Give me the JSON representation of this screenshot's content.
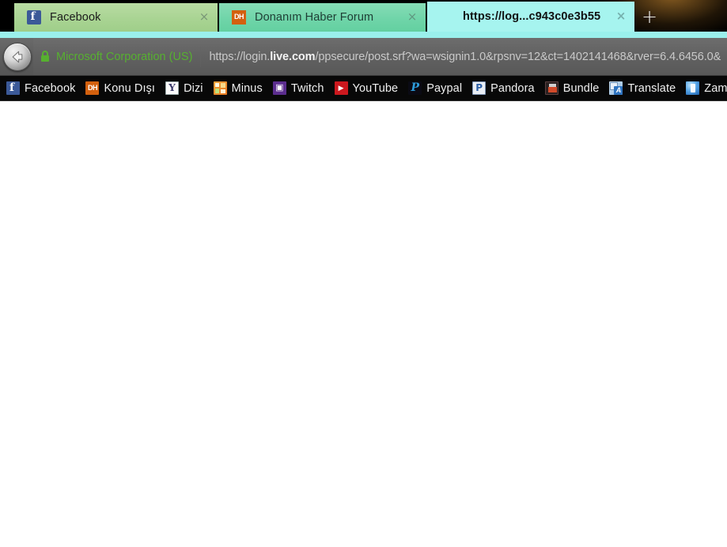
{
  "browser": {
    "tabs": [
      {
        "title": "Facebook",
        "favicon": "facebook-icon",
        "close_label": "×",
        "active": false
      },
      {
        "title": "Donanım Haber Forum",
        "favicon": "donanimhaber-icon",
        "close_label": "×",
        "active": false
      },
      {
        "title": "https://log...c943c0e3b55",
        "favicon": "microsoft-icon",
        "close_label": "×",
        "active": true
      }
    ],
    "new_tab_label": "+",
    "toolbar": {
      "back_button_label": "Back",
      "site_identity": "Microsoft Corporation (US)",
      "url_prefix": "https://login.",
      "url_host": "live.com",
      "url_suffix": "/ppsecure/post.srf?wa=wsignin1.0&rpsnv=12&ct=1402141468&rver=6.4.6456.0&",
      "url_full": "https://login.live.com/ppsecure/post.srf?wa=wsignin1.0&rpsnv=12&ct=1402141468&rver=6.4.6456.0&"
    },
    "bookmarks": [
      {
        "label": "Facebook",
        "icon": "facebook-icon"
      },
      {
        "label": "Konu Dışı",
        "icon": "donanimhaber-icon"
      },
      {
        "label": "Dizi",
        "icon": "yahoo-icon"
      },
      {
        "label": "Minus",
        "icon": "minus-icon"
      },
      {
        "label": "Twitch",
        "icon": "twitch-icon"
      },
      {
        "label": "YouTube",
        "icon": "youtube-icon"
      },
      {
        "label": "Paypal",
        "icon": "paypal-icon"
      },
      {
        "label": "Pandora",
        "icon": "pandora-icon"
      },
      {
        "label": "Bundle",
        "icon": "bundle-icon"
      },
      {
        "label": "Translate",
        "icon": "translate-icon"
      },
      {
        "label": "Zamunda",
        "icon": "zamunda-icon"
      }
    ],
    "icon_glyphs": {
      "donanimhaber": "DH",
      "yahoo": "Y",
      "twitch": "▣",
      "youtube": "▶",
      "paypal": "P",
      "pandora": "P",
      "translate": "A"
    },
    "page": {
      "content": ""
    },
    "colors": {
      "tab_inactive_1": "#a9d493",
      "tab_inactive_2": "#6ed4a8",
      "tab_active": "#a6f4ef",
      "tabstrip_background": "#000000",
      "toolbar_background": "#606060",
      "bookmarks_background": "#080808",
      "site_identity_text": "#57b030",
      "url_text": "#c9c9c9",
      "page_background": "#ffffff"
    }
  }
}
